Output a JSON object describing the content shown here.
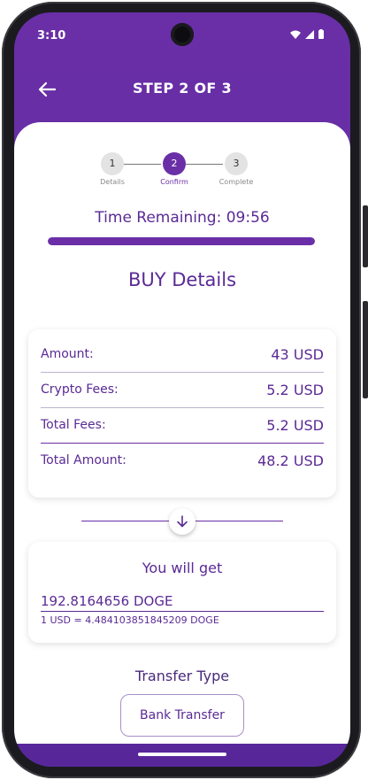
{
  "status_bar": {
    "time": "3:10"
  },
  "header": {
    "title": "STEP 2 OF 3"
  },
  "stepper": {
    "steps": [
      {
        "number": "1",
        "label": "Details"
      },
      {
        "number": "2",
        "label": "Confirm"
      },
      {
        "number": "3",
        "label": "Complete"
      }
    ],
    "active_step": 2
  },
  "timer": {
    "text": "Time Remaining: 09:56",
    "progress": 1.0
  },
  "buy_details": {
    "title": "BUY Details",
    "rows": [
      {
        "label": "Amount:",
        "value": "43 USD"
      },
      {
        "label": "Crypto Fees:",
        "value": "5.2 USD"
      },
      {
        "label": "Total Fees:",
        "value": "5.2 USD"
      },
      {
        "label": "Total Amount:",
        "value": "48.2 USD"
      }
    ]
  },
  "receive": {
    "title": "You will get",
    "amount": "192.8164656 DOGE",
    "rate": "1 USD = 4.484103851845209 DOGE"
  },
  "transfer": {
    "title": "Transfer Type",
    "option": "Bank Transfer"
  },
  "colors": {
    "primary": "#6a2fa7",
    "text": "#5a2a95"
  },
  "icons": [
    "arrow-left-icon",
    "arrow-down-icon",
    "wifi-icon",
    "signal-icon",
    "battery-icon",
    "camera-icon"
  ]
}
